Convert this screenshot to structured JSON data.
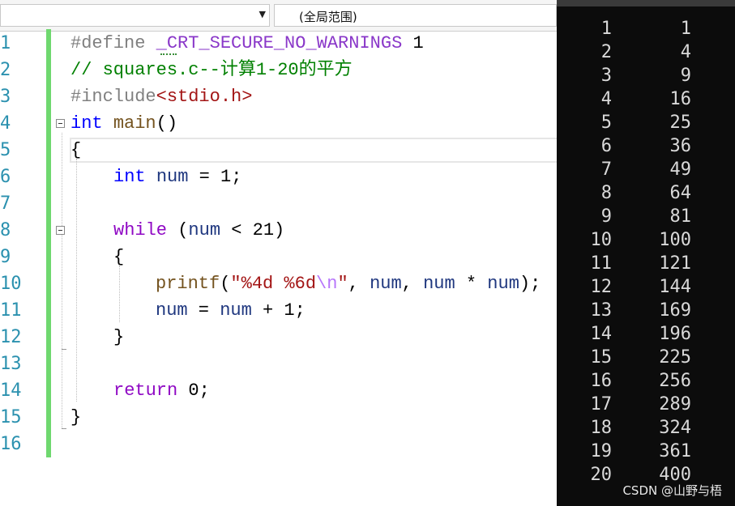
{
  "scope_bar": {
    "scope_label": "(全局范围)"
  },
  "line_numbers": [
    "1",
    "2",
    "3",
    "4",
    "5",
    "6",
    "7",
    "8",
    "9",
    "10",
    "11",
    "12",
    "13",
    "14",
    "15",
    "16"
  ],
  "code": {
    "l1_directive": "#define",
    "l1_macro": "_CRT_SECURE_NO_WARNINGS",
    "l1_value": "1",
    "l2_comment": "// squares.c--计算1-20的平方",
    "l3_directive": "#include",
    "l3_header": "<stdio.h>",
    "l4_type": "int",
    "l4_func": "main",
    "l4_parens": "()",
    "l5": "{",
    "l6_type": "int",
    "l6_var": "num",
    "l6_rest": " = 1;",
    "l8_kw": "while",
    "l8_open": " (",
    "l8_var": "num",
    "l8_rest": " < 21)",
    "l9": "{",
    "l10_func": "printf",
    "l10_open": "(",
    "l10_str": "\"%4d %6d",
    "l10_esc": "\\n",
    "l10_strend": "\"",
    "l10_sep1": ", ",
    "l10_var1": "num",
    "l10_sep2": ", ",
    "l10_var2": "num",
    "l10_op": " * ",
    "l10_var3": "num",
    "l10_end": ");",
    "l11_var1": "num",
    "l11_mid": " = ",
    "l11_var2": "num",
    "l11_end": " + 1;",
    "l12": "}",
    "l14_kw": "return",
    "l14_rest": " 0;",
    "l15": "}"
  },
  "console": {
    "rows": [
      [
        "1",
        "1"
      ],
      [
        "2",
        "4"
      ],
      [
        "3",
        "9"
      ],
      [
        "4",
        "16"
      ],
      [
        "5",
        "25"
      ],
      [
        "6",
        "36"
      ],
      [
        "7",
        "49"
      ],
      [
        "8",
        "64"
      ],
      [
        "9",
        "81"
      ],
      [
        "10",
        "100"
      ],
      [
        "11",
        "121"
      ],
      [
        "12",
        "144"
      ],
      [
        "13",
        "169"
      ],
      [
        "14",
        "196"
      ],
      [
        "15",
        "225"
      ],
      [
        "16",
        "256"
      ],
      [
        "17",
        "289"
      ],
      [
        "18",
        "324"
      ],
      [
        "19",
        "361"
      ],
      [
        "20",
        "400"
      ]
    ]
  },
  "watermark": "CSDN @山野与梧",
  "colors": {
    "line_number": "#2b91af",
    "keyword": "#0000ff",
    "control": "#8f08c4",
    "comment": "#008000",
    "string": "#a31515",
    "console_bg": "#0c0c0c",
    "change_bar": "#6fd86f"
  }
}
